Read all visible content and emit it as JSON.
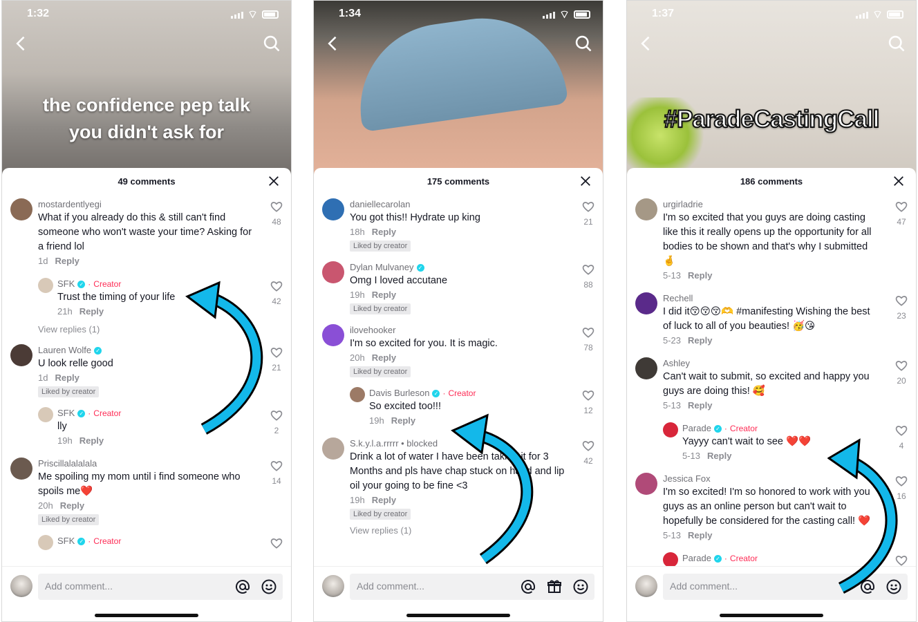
{
  "panels": [
    {
      "time": "1:32",
      "overlay": "the confidence pep talk you didn't ask for",
      "comment_count": "49 comments",
      "input_placeholder": "Add comment...",
      "comments": [
        {
          "user": "mostardentlyegi",
          "text": "What if you already do this & still can't find someone who won't waste your time? Asking for a friend lol",
          "age": "1d",
          "reply": "Reply",
          "likes": "48",
          "avatar": "#8a6a55"
        },
        {
          "user": "SFK",
          "creator": "Creator",
          "text": "Trust the timing of your life",
          "age": "21h",
          "reply": "Reply",
          "likes": "42",
          "is_reply": true,
          "avatar": "#d8c9b8"
        },
        {
          "view_replies": "View replies (1)"
        },
        {
          "user": "Lauren Wolfe",
          "verified": true,
          "text": "U look relle good",
          "age": "1d",
          "reply": "Reply",
          "liked": "Liked by creator",
          "likes": "21",
          "avatar": "#4b3b36"
        },
        {
          "user": "SFK",
          "creator": "Creator",
          "text": "lly",
          "age": "19h",
          "reply": "Reply",
          "likes": "2",
          "is_reply": true,
          "avatar": "#d8c9b8"
        },
        {
          "user": "Priscillalalalala",
          "text": "Me spoiling my mom until i find someone who spoils me❤️",
          "age": "20h",
          "reply": "Reply",
          "liked": "Liked by creator",
          "likes": "14",
          "avatar": "#6b5a4f"
        },
        {
          "user": "SFK",
          "creator": "Creator",
          "text": "",
          "age": "",
          "reply": "",
          "likes": "",
          "is_reply": true,
          "avatar": "#d8c9b8"
        }
      ]
    },
    {
      "time": "1:34",
      "overlay": "",
      "comment_count": "175 comments",
      "input_placeholder": "Add comment...",
      "comments": [
        {
          "user": "daniellecarolan",
          "text": "You got this!! Hydrate up king",
          "age": "18h",
          "reply": "Reply",
          "liked": "Liked by creator",
          "likes": "21",
          "avatar": "#2f6fb3"
        },
        {
          "user": "Dylan Mulvaney",
          "verified": true,
          "text": "Omg I loved accutane",
          "age": "19h",
          "reply": "Reply",
          "liked": "Liked by creator",
          "likes": "88",
          "avatar": "#c9566f"
        },
        {
          "user": "ilovehooker",
          "text": "I'm so excited for you. It is magic.",
          "age": "20h",
          "reply": "Reply",
          "liked": "Liked by creator",
          "likes": "78",
          "avatar": "#8a4fd6"
        },
        {
          "user": "Davis Burleson",
          "verified": true,
          "creator": "Creator",
          "text": "So excited too!!!",
          "age": "19h",
          "reply": "Reply",
          "likes": "12",
          "is_reply": true,
          "avatar": "#9c7a66"
        },
        {
          "user": "S.k.y.l.a.rrrrr • blocked",
          "text": "Drink a lot of water I have been taking it for 3 Months and pls have chap stuck on hand and lip oil your going to be fine <3",
          "age": "19h",
          "reply": "Reply",
          "liked": "Liked by creator",
          "likes": "42",
          "avatar": "#b7a79b"
        },
        {
          "view_replies": "View replies (1)"
        }
      ]
    },
    {
      "time": "1:37",
      "overlay": "#ParadeCastingCall",
      "comment_count": "186 comments",
      "input_placeholder": "Add comment...",
      "comments": [
        {
          "user": "urgirladrie",
          "text": "I'm so excited that you guys are doing casting like this it really opens up the opportunity for all bodies to be shown and that's why I submitted 🤞",
          "age": "5-13",
          "reply": "Reply",
          "likes": "47",
          "avatar": "#a59886"
        },
        {
          "user": "Rechell",
          "text": "I did it😚😚😚🫶 #manifesting Wishing the best of luck to all of you beauties! 🥳😘",
          "age": "5-23",
          "reply": "Reply",
          "likes": "23",
          "avatar": "#5a2a8a"
        },
        {
          "user": "Ashley",
          "text": "Can't wait to submit, so excited and happy you guys are doing this! 🥰",
          "age": "5-13",
          "reply": "Reply",
          "likes": "20",
          "avatar": "#3f3a36"
        },
        {
          "user": "Parade",
          "verified": true,
          "creator": "Creator",
          "text": "Yayyy can't wait to see ❤️❤️",
          "age": "5-13",
          "reply": "Reply",
          "likes": "4",
          "is_reply": true,
          "avatar": "#d8263a"
        },
        {
          "user": "Jessica Fox",
          "text": "I'm so excited! I'm so honored to work with you guys as an online person but can't wait to hopefully be considered for the casting call! ❤️",
          "age": "5-13",
          "reply": "Reply",
          "likes": "16",
          "avatar": "#b04a78"
        },
        {
          "user": "Parade",
          "verified": true,
          "creator": "Creator",
          "text": "",
          "age": "",
          "reply": "",
          "likes": "",
          "is_reply": true,
          "avatar": "#d8263a"
        }
      ]
    }
  ],
  "colors": {
    "arrow": "#13b8ea",
    "creator": "#fe2c55",
    "verified": "#20d5ec"
  },
  "icons": [
    "back-icon",
    "search-icon",
    "close-icon",
    "heart-icon",
    "mention-icon",
    "gift-icon",
    "emoji-icon"
  ]
}
